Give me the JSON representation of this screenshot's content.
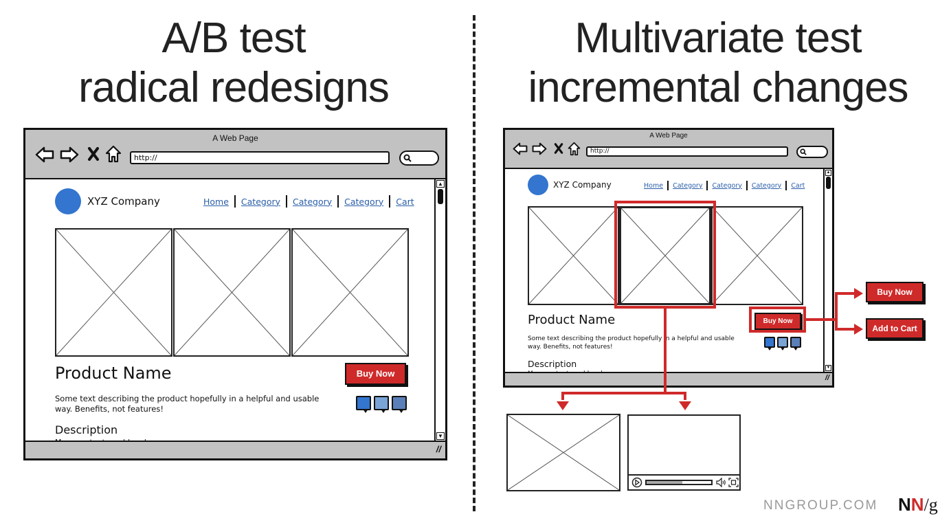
{
  "left": {
    "heading": [
      "A/B test",
      "radical redesigns"
    ],
    "browser": {
      "title": "A Web Page",
      "url": "http://",
      "company": "XYZ Company",
      "nav": [
        "Home",
        "Category",
        "Category",
        "Category",
        "Cart"
      ],
      "product_name": "Product Name",
      "product_desc": "Some text describing the product hopefully in a helpful and usable way. Benefits, not features!",
      "description_title": "Description",
      "more_content": "More content would go here",
      "buy_label": "Buy Now"
    }
  },
  "right": {
    "heading": [
      "Multivariate test",
      "incremental changes"
    ],
    "browser": {
      "title": "A Web Page",
      "url": "http://",
      "company": "XYZ Company",
      "nav": [
        "Home",
        "Category",
        "Category",
        "Category",
        "Cart"
      ],
      "product_name": "Product Name",
      "product_desc": "Some text describing the product hopefully in a helpful and usable way. Benefits, not features!",
      "description_title": "Description",
      "more_content": "More content would go here",
      "buy_label": "Buy Now"
    },
    "variants": {
      "button_a": "Buy Now",
      "button_b": "Add to Cart",
      "media_a": "image placeholder",
      "media_b": "video player",
      "video_progress": 0.55
    }
  },
  "footer": {
    "site": "NNGROUP.COM",
    "brand_n1": "N",
    "brand_n2": "N",
    "brand_g": "/g"
  },
  "colors": {
    "accent_red": "#cf2a2a",
    "logo_blue": "#3375cf",
    "link_blue": "#2a5ea8",
    "chrome_gray": "#c2c2c2",
    "swatches": [
      "#3375cf",
      "#7aa3d6",
      "#5b7fb8"
    ]
  }
}
